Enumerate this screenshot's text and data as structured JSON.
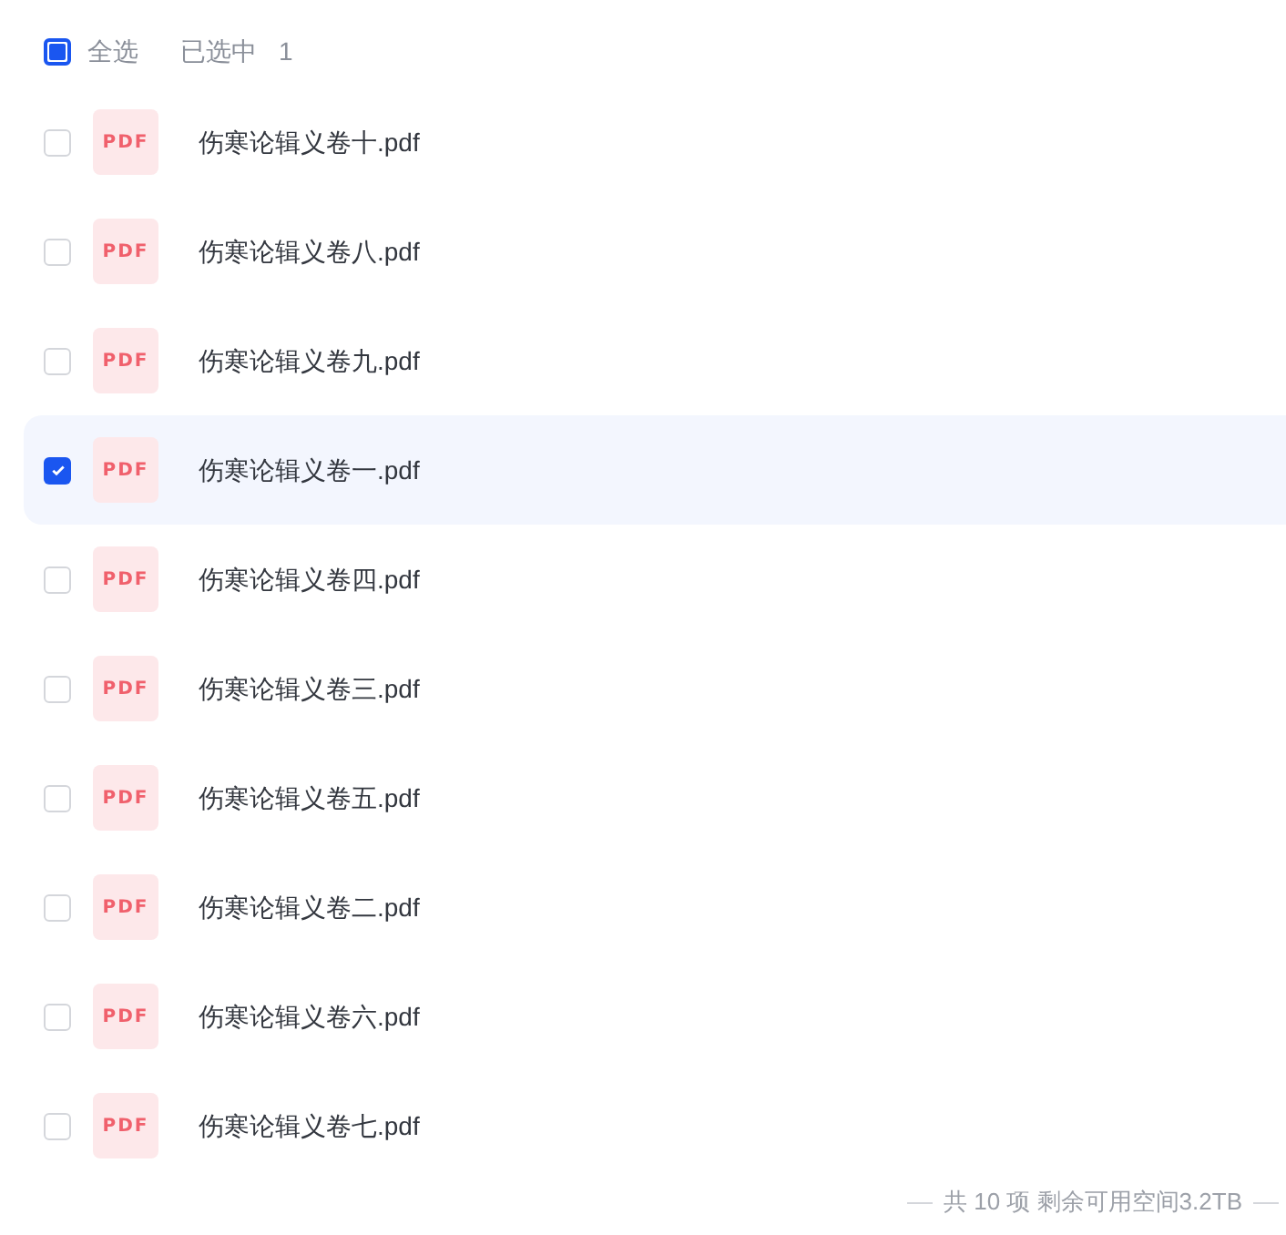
{
  "header": {
    "select_all": {
      "label": "全选",
      "indeterminate": true
    },
    "selected_label": "已选中",
    "selected_count": "1"
  },
  "files": [
    {
      "name": "伤寒论辑义卷十.pdf",
      "icon": "PDF",
      "selected": false
    },
    {
      "name": "伤寒论辑义卷八.pdf",
      "icon": "PDF",
      "selected": false
    },
    {
      "name": "伤寒论辑义卷九.pdf",
      "icon": "PDF",
      "selected": false
    },
    {
      "name": "伤寒论辑义卷一.pdf",
      "icon": "PDF",
      "selected": true
    },
    {
      "name": "伤寒论辑义卷四.pdf",
      "icon": "PDF",
      "selected": false
    },
    {
      "name": "伤寒论辑义卷三.pdf",
      "icon": "PDF",
      "selected": false
    },
    {
      "name": "伤寒论辑义卷五.pdf",
      "icon": "PDF",
      "selected": false
    },
    {
      "name": "伤寒论辑义卷二.pdf",
      "icon": "PDF",
      "selected": false
    },
    {
      "name": "伤寒论辑义卷六.pdf",
      "icon": "PDF",
      "selected": false
    },
    {
      "name": "伤寒论辑义卷七.pdf",
      "icon": "PDF",
      "selected": false
    }
  ],
  "footer": "共 10 项 剩余可用空间3.2TB"
}
